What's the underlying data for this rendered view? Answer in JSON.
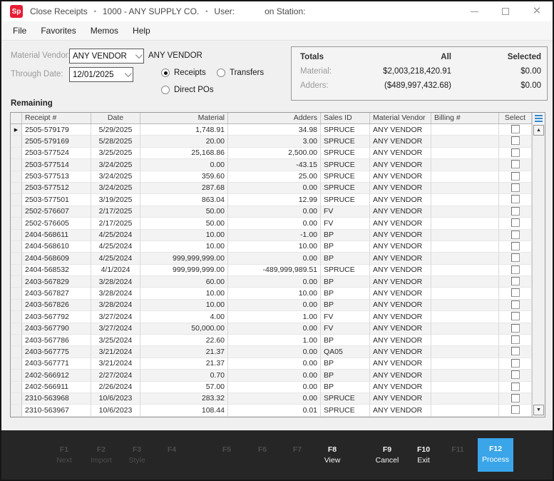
{
  "window": {
    "logo": "Sp",
    "title_parts": [
      "Close Receipts",
      "1000 - ANY SUPPLY CO.",
      "User:",
      "on Station:"
    ],
    "separator": "•"
  },
  "menu": {
    "items": [
      "File",
      "Favorites",
      "Memos",
      "Help"
    ]
  },
  "filters": {
    "material_vendor_label": "Material Vendor:",
    "material_vendor_value": "ANY VENDOR",
    "material_vendor_display": "ANY VENDOR",
    "through_date_label": "Through Date:",
    "through_date_value": "12/01/2025",
    "radios": [
      {
        "label": "Receipts",
        "selected": true
      },
      {
        "label": "Transfers",
        "selected": false
      },
      {
        "label": "Direct POs",
        "selected": false
      }
    ]
  },
  "totals": {
    "title": "Totals",
    "col_all": "All",
    "col_selected": "Selected",
    "rows": [
      {
        "label": "Material:",
        "all": "$2,003,218,420.91",
        "selected": "$0.00"
      },
      {
        "label": "Adders:",
        "all": "($489,997,432.68)",
        "selected": "$0.00"
      }
    ]
  },
  "section_label": "Remaining",
  "grid": {
    "columns": [
      "Receipt #",
      "Date",
      "Material",
      "Adders",
      "Sales ID",
      "Material Vendor",
      "Billing #",
      "Select"
    ],
    "rows": [
      {
        "receipt": "2505-579179",
        "date": "5/29/2025",
        "material": "1,748.91",
        "adders": "34.98",
        "sales_id": "SPRUCE",
        "vendor": "ANY VENDOR",
        "billing": ""
      },
      {
        "receipt": "2505-579169",
        "date": "5/28/2025",
        "material": "20.00",
        "adders": "3.00",
        "sales_id": "SPRUCE",
        "vendor": "ANY VENDOR",
        "billing": ""
      },
      {
        "receipt": "2503-577524",
        "date": "3/25/2025",
        "material": "25,168.86",
        "adders": "2,500.00",
        "sales_id": "SPRUCE",
        "vendor": "ANY VENDOR",
        "billing": ""
      },
      {
        "receipt": "2503-577514",
        "date": "3/24/2025",
        "material": "0.00",
        "adders": "-43.15",
        "sales_id": "SPRUCE",
        "vendor": "ANY VENDOR",
        "billing": ""
      },
      {
        "receipt": "2503-577513",
        "date": "3/24/2025",
        "material": "359.60",
        "adders": "25.00",
        "sales_id": "SPRUCE",
        "vendor": "ANY VENDOR",
        "billing": ""
      },
      {
        "receipt": "2503-577512",
        "date": "3/24/2025",
        "material": "287.68",
        "adders": "0.00",
        "sales_id": "SPRUCE",
        "vendor": "ANY VENDOR",
        "billing": ""
      },
      {
        "receipt": "2503-577501",
        "date": "3/19/2025",
        "material": "863.04",
        "adders": "12.99",
        "sales_id": "SPRUCE",
        "vendor": "ANY VENDOR",
        "billing": ""
      },
      {
        "receipt": "2502-576607",
        "date": "2/17/2025",
        "material": "50.00",
        "adders": "0.00",
        "sales_id": "FV",
        "vendor": "ANY VENDOR",
        "billing": ""
      },
      {
        "receipt": "2502-576605",
        "date": "2/17/2025",
        "material": "50.00",
        "adders": "0.00",
        "sales_id": "FV",
        "vendor": "ANY VENDOR",
        "billing": ""
      },
      {
        "receipt": "2404-568611",
        "date": "4/25/2024",
        "material": "10.00",
        "adders": "-1.00",
        "sales_id": "BP",
        "vendor": "ANY VENDOR",
        "billing": ""
      },
      {
        "receipt": "2404-568610",
        "date": "4/25/2024",
        "material": "10.00",
        "adders": "10.00",
        "sales_id": "BP",
        "vendor": "ANY VENDOR",
        "billing": ""
      },
      {
        "receipt": "2404-568609",
        "date": "4/25/2024",
        "material": "999,999,999.00",
        "adders": "0.00",
        "sales_id": "BP",
        "vendor": "ANY VENDOR",
        "billing": ""
      },
      {
        "receipt": "2404-568532",
        "date": "4/1/2024",
        "material": "999,999,999.00",
        "adders": "-489,999,989.51",
        "sales_id": "SPRUCE",
        "vendor": "ANY VENDOR",
        "billing": ""
      },
      {
        "receipt": "2403-567829",
        "date": "3/28/2024",
        "material": "60.00",
        "adders": "0.00",
        "sales_id": "BP",
        "vendor": "ANY VENDOR",
        "billing": ""
      },
      {
        "receipt": "2403-567827",
        "date": "3/28/2024",
        "material": "10.00",
        "adders": "10.00",
        "sales_id": "BP",
        "vendor": "ANY VENDOR",
        "billing": ""
      },
      {
        "receipt": "2403-567826",
        "date": "3/28/2024",
        "material": "10.00",
        "adders": "0.00",
        "sales_id": "BP",
        "vendor": "ANY VENDOR",
        "billing": ""
      },
      {
        "receipt": "2403-567792",
        "date": "3/27/2024",
        "material": "4.00",
        "adders": "1.00",
        "sales_id": "FV",
        "vendor": "ANY VENDOR",
        "billing": ""
      },
      {
        "receipt": "2403-567790",
        "date": "3/27/2024",
        "material": "50,000.00",
        "adders": "0.00",
        "sales_id": "FV",
        "vendor": "ANY VENDOR",
        "billing": ""
      },
      {
        "receipt": "2403-567786",
        "date": "3/25/2024",
        "material": "22.60",
        "adders": "1.00",
        "sales_id": "BP",
        "vendor": "ANY VENDOR",
        "billing": ""
      },
      {
        "receipt": "2403-567775",
        "date": "3/21/2024",
        "material": "21.37",
        "adders": "0.00",
        "sales_id": "QA05",
        "vendor": "ANY VENDOR",
        "billing": ""
      },
      {
        "receipt": "2403-567771",
        "date": "3/21/2024",
        "material": "21.37",
        "adders": "0.00",
        "sales_id": "BP",
        "vendor": "ANY VENDOR",
        "billing": ""
      },
      {
        "receipt": "2402-566912",
        "date": "2/27/2024",
        "material": "0.70",
        "adders": "0.00",
        "sales_id": "BP",
        "vendor": "ANY VENDOR",
        "billing": ""
      },
      {
        "receipt": "2402-566911",
        "date": "2/26/2024",
        "material": "57.00",
        "adders": "0.00",
        "sales_id": "BP",
        "vendor": "ANY VENDOR",
        "billing": ""
      },
      {
        "receipt": "2310-563968",
        "date": "10/6/2023",
        "material": "283.32",
        "adders": "0.00",
        "sales_id": "SPRUCE",
        "vendor": "ANY VENDOR",
        "billing": ""
      },
      {
        "receipt": "2310-563967",
        "date": "10/6/2023",
        "material": "108.44",
        "adders": "0.01",
        "sales_id": "SPRUCE",
        "vendor": "ANY VENDOR",
        "billing": ""
      }
    ]
  },
  "function_keys": [
    {
      "key": "F1",
      "label": "Next",
      "enabled": false
    },
    {
      "key": "F2",
      "label": "Import",
      "enabled": false
    },
    {
      "key": "F3",
      "label": "Style",
      "enabled": false
    },
    {
      "key": "F4",
      "label": "",
      "enabled": false
    },
    {
      "key": "F5",
      "label": "",
      "enabled": false
    },
    {
      "key": "F6",
      "label": "",
      "enabled": false
    },
    {
      "key": "F7",
      "label": "",
      "enabled": false
    },
    {
      "key": "F8",
      "label": "View",
      "enabled": true
    },
    {
      "key": "F9",
      "label": "Cancel",
      "enabled": true
    },
    {
      "key": "F10",
      "label": "Exit",
      "enabled": true
    },
    {
      "key": "F11",
      "label": "",
      "enabled": false
    },
    {
      "key": "F12",
      "label": "Process",
      "enabled": true,
      "highlight": true
    }
  ],
  "colors": {
    "accent_blue": "#3aa5e8",
    "logo_red": "#e81c34"
  }
}
